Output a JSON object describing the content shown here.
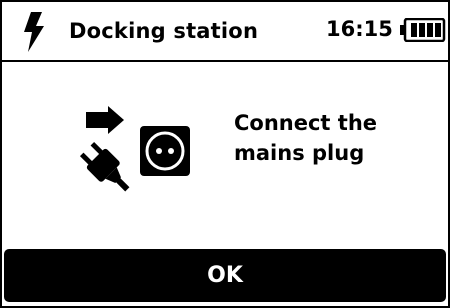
{
  "header": {
    "title": "Docking station",
    "time": "16:15",
    "battery_icon": "battery-full-icon",
    "status_icon": "lightning-bolt-icon"
  },
  "main": {
    "icon": "connect-mains-plug-icon",
    "message_line1": "Connect the",
    "message_line2": "mains plug"
  },
  "actions": {
    "ok_label": "OK"
  }
}
